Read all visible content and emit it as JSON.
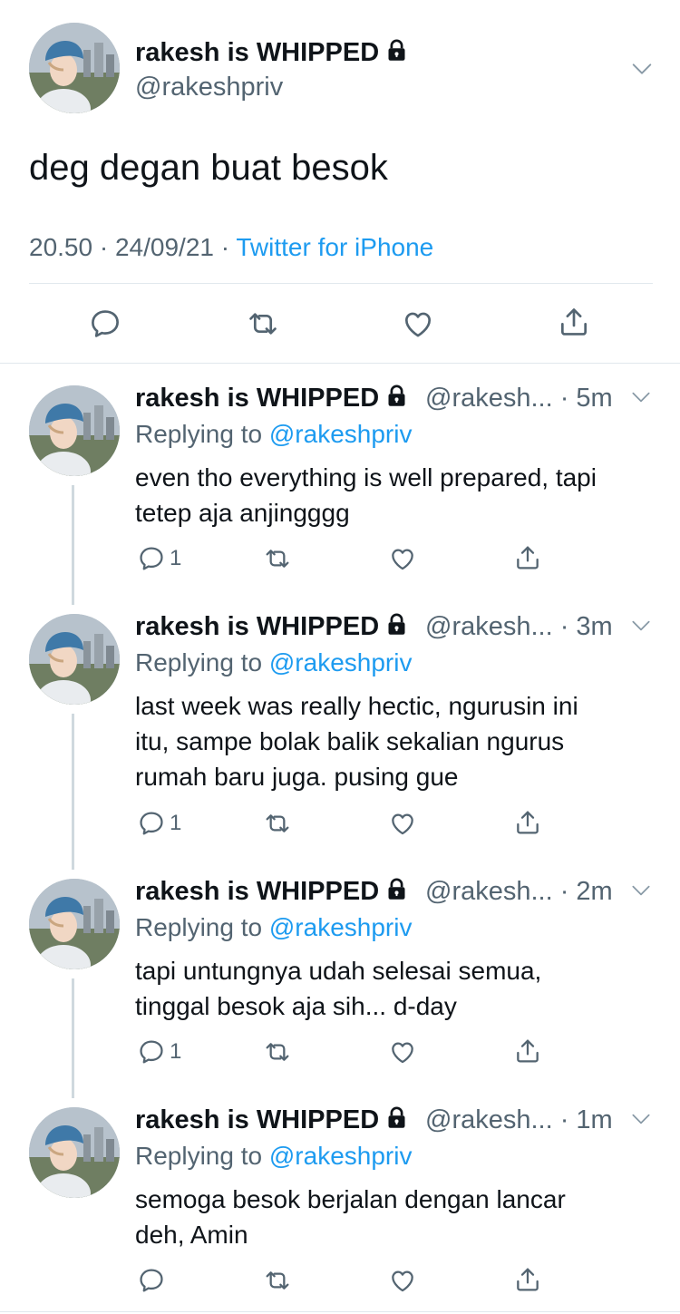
{
  "main_tweet": {
    "display_name": "rakesh is WHIPPED",
    "handle": "@rakeshpriv",
    "text": "deg degan buat besok",
    "time": "20.50",
    "date": "24/09/21",
    "source": "Twitter for iPhone",
    "separator": "·"
  },
  "replies": [
    {
      "display_name": "rakesh is WHIPPED",
      "handle": "@rakesh...",
      "time": "· 5m",
      "replying_prefix": "Replying to ",
      "replying_to": "@rakeshpriv",
      "line1": "even tho everything is well prepared, tapi",
      "line2": "tetep aja anjingggg",
      "line3": "",
      "reply_count": "1"
    },
    {
      "display_name": "rakesh is WHIPPED",
      "handle": "@rakesh...",
      "time": "· 3m",
      "replying_prefix": "Replying to ",
      "replying_to": "@rakeshpriv",
      "line1": "last week was really hectic, ngurusin ini",
      "line2": "itu, sampe bolak balik sekalian ngurus",
      "line3": "rumah baru juga. pusing gue",
      "reply_count": "1"
    },
    {
      "display_name": "rakesh is WHIPPED",
      "handle": "@rakesh...",
      "time": "· 2m",
      "replying_prefix": "Replying to ",
      "replying_to": "@rakeshpriv",
      "line1": "tapi untungnya udah selesai semua,",
      "line2": "tinggal besok aja sih... d-day",
      "line3": "",
      "reply_count": "1"
    },
    {
      "display_name": "rakesh is WHIPPED",
      "handle": "@rakesh...",
      "time": "· 1m",
      "replying_prefix": "Replying to ",
      "replying_to": "@rakeshpriv",
      "line1": "semoga besok berjalan dengan lancar",
      "line2": "deh, Amin",
      "line3": "",
      "reply_count": ""
    }
  ],
  "colors": {
    "accent": "#1d9bf0",
    "muted": "#536471",
    "text": "#0f1419",
    "divider": "#e1e8ed"
  },
  "icons": [
    "chevron-down-icon",
    "lock-icon",
    "reply-icon",
    "retweet-icon",
    "like-icon",
    "share-icon"
  ]
}
